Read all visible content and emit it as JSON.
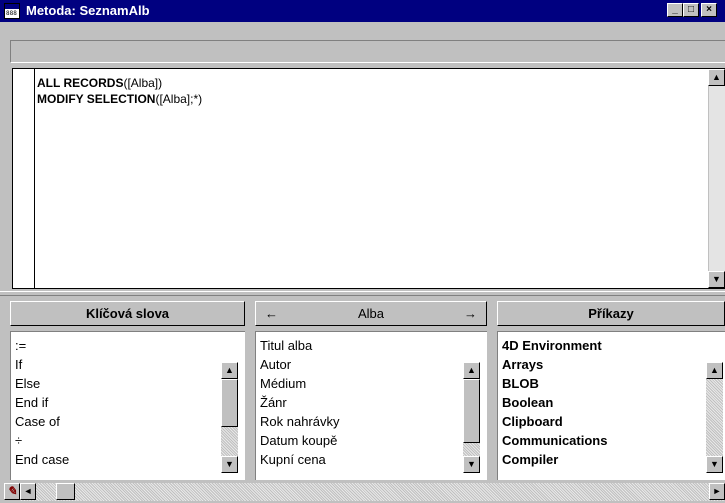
{
  "window": {
    "title": "Metoda: SeznamAlb",
    "app_icon": "4d-method-icon",
    "app_icon_text": "888"
  },
  "title_buttons": {
    "minimize": "_",
    "maximize": "□",
    "close": "×"
  },
  "editor": {
    "lines": [
      {
        "keyword": "ALL RECORDS",
        "args": "([Alba])"
      },
      {
        "keyword": "MODIFY SELECTION",
        "args": "([Alba];*)"
      }
    ]
  },
  "panels": {
    "keywords": {
      "header": "Klíčová slova",
      "items": [
        ":=",
        "If",
        "Else",
        "End if",
        "Case of",
        "÷",
        "End case"
      ]
    },
    "table": {
      "header": "Alba",
      "prev_arrow": "←",
      "next_arrow": "→",
      "items": [
        "Titul alba",
        "Autor",
        "Médium",
        "Žánr",
        "Rok nahrávky",
        "Datum koupě",
        "Kupní cena"
      ]
    },
    "commands": {
      "header": "Příkazy",
      "items": [
        "4D Environment",
        "Arrays",
        "BLOB",
        "Boolean",
        "Clipboard",
        "Communications",
        "Compiler"
      ]
    }
  },
  "scroll_arrows": {
    "up": "▲",
    "down": "▼",
    "left": "◄",
    "right": "►"
  },
  "colors": {
    "titlebar": "#000080",
    "face": "#c0c0c0",
    "editor_bg": "#ffffff"
  }
}
